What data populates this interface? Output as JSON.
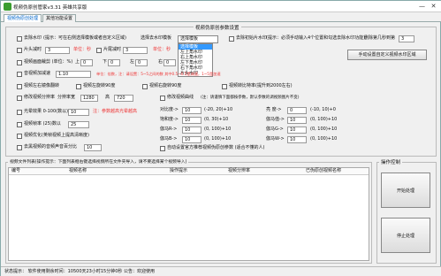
{
  "window": {
    "title": "视频伪原创管家v3.31 英雄共享版",
    "minimize": "—",
    "close": "✕"
  },
  "tabs": [
    {
      "label": "视频伪原创处理"
    },
    {
      "label": "其他功能设置"
    }
  ],
  "params": {
    "title": "视频伪原创参数设置",
    "remove_watermark_label": "去除水印",
    "remove_watermark_hint": "(提示：可在右侧选择模板或者自定义区域)",
    "template_label": "选择去水印模板",
    "template_selected": "选择模板",
    "template_options": [
      "选择模板",
      "左上角水印",
      "右上角水印",
      "左下角水印",
      "右下角水印",
      "片头水印",
      "片尾水印"
    ],
    "manual_watermark_label": "去除初始片水印",
    "manual_watermark_hint": "(提示：必须手动输入4个位置和勾选去除水印功能)",
    "delete_seconds_label": "删除第几秒到第",
    "delete_seconds_value": "3",
    "manual_region_button": "手动设置自定义视频水印区域",
    "intro_label": "片头减时",
    "intro_value": "3",
    "intro_unit": "单位：秒",
    "outro_label": "片尾减时",
    "outro_value": "3",
    "outro_unit": "单位：秒",
    "frame_label": "视频画面裁剪 (单位：%)",
    "frame_top_label": "上",
    "frame_top_value": "0",
    "frame_bottom_label": "下",
    "frame_bottom_value": "0",
    "frame_left_label": "左",
    "frame_left_value": "0",
    "frame_right_label": "右",
    "frame_right_value": "0",
    "speed_label": "音视频加减速",
    "speed_value": "1.10",
    "speed_hint": "单位：倍数，注：请设置：5~5之间的数  其中0.5~0.5是减速，1~5是加速",
    "mirror_label": "视频左右镜像翻转",
    "rotate90_label": "视频左旋转90度",
    "rotate_right90_label": "视频右旋转90度",
    "bitrate_label": "视频转比特率(提升到2000左右)",
    "resolution_label": "修改视频分辨率",
    "res_width_label": "分辨率宽",
    "res_width_value": "1280",
    "res_height_label": "高",
    "res_height_value": "720",
    "fade_label": "光晕效果 0-100(数以)",
    "fade_value": "10",
    "fade_hint": "注：参数越高光晕越高",
    "fps_label": "视频帧率 (25)数以",
    "fps_value": "25",
    "optimize_label": "视频优化(英帧视频上提高清晰度)",
    "video_noise_label": "去黑视频的音频声音百分比",
    "video_noise_value": "10",
    "params_label": "修改视频曲线",
    "params_hint": "(注：请谨慎下面都按参数，默认参数的调视频图片不变)",
    "contrast_label": "对比度->",
    "contrast_value": "10",
    "contrast_range": "(-20, 20)+10",
    "brightness_label": "亮  度->",
    "brightness_value": "0",
    "brightness_range": "(-10, 10)+0",
    "saturation_label": "饱和度->",
    "saturation_value": "10",
    "saturation_range": "(0, 30)+10",
    "gamma_label": "伽马值->",
    "gamma_value": "10",
    "gamma_range": "(0, 100)+10",
    "gamma_r_label": "伽马R->",
    "gamma_r_value": "10",
    "gamma_r_range": "(0, 100)+10",
    "gamma_g_label": "伽马G->",
    "gamma_g_value": "10",
    "gamma_g_range": "(0, 100)+10",
    "gamma_b_label": "伽马B->",
    "gamma_b_value": "10",
    "gamma_b_range": "(0, 100)+10",
    "gamma_w_label": "伽马W->",
    "gamma_w_value": "10",
    "gamma_w_range": "(0, 100)+10",
    "auto_label": "自动设置官方推荐视频伪原创参数 (适合不懂的人)"
  },
  "filelist": {
    "title": "视频文件列表(操作提示：下面列表框右键选择视频所在文件夹导入，请不要选择某个视频导入)",
    "columns": [
      "编号",
      "视频名称",
      "操作提示",
      "视频分辨率",
      "已伪原创视频名称"
    ]
  },
  "control": {
    "title": "操作控制",
    "start": "开始处理",
    "stop": "停止处理"
  },
  "statusbar": {
    "text": "状态提示：    软件使用剩余时间：10500天23小时15分钟0秒 公告：欢迎使用"
  }
}
